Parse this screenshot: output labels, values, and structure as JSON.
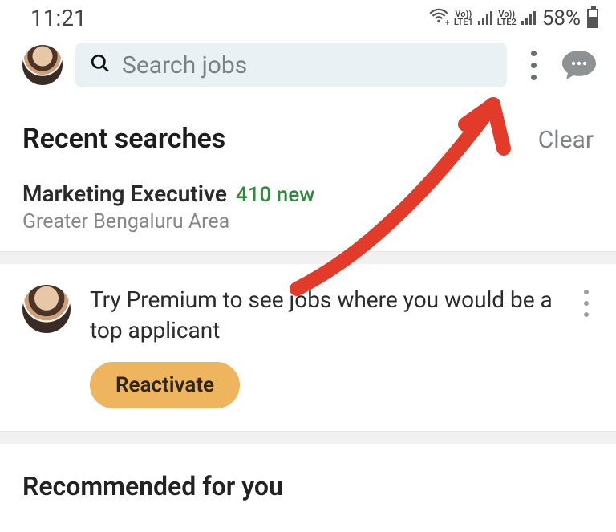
{
  "status": {
    "time": "11:21",
    "lte1": "LTE1",
    "lte2": "LTE2",
    "vo": "Vo))",
    "battery": "58%"
  },
  "header": {
    "search_placeholder": "Search jobs"
  },
  "recent": {
    "title": "Recent searches",
    "clear": "Clear",
    "item": {
      "title": "Marketing Executive",
      "new": "410 new",
      "sub": "Greater Bengaluru Area"
    }
  },
  "premium": {
    "text": "Try Premium to see jobs where you would be a top applicant",
    "cta": "Reactivate"
  },
  "recommended": {
    "title": "Recommended for you"
  }
}
